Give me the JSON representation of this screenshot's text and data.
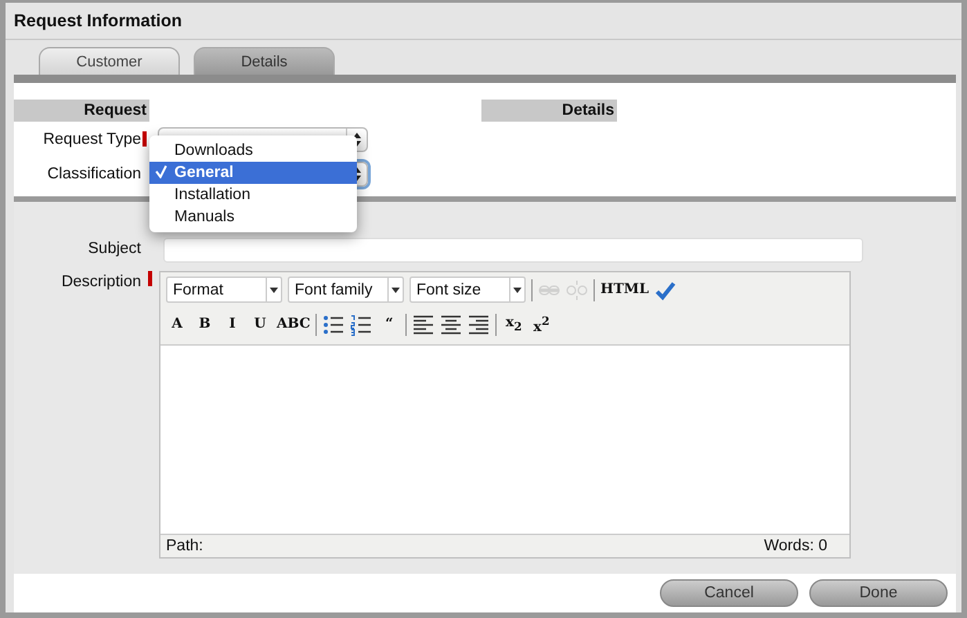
{
  "window": {
    "title": "Request Information"
  },
  "tabs": [
    {
      "label": "Customer",
      "selected": false
    },
    {
      "label": "Details",
      "selected": true
    }
  ],
  "headers": [
    "Request",
    "Details"
  ],
  "fields": [
    {
      "label": "Request Type",
      "required": true,
      "focused": false
    },
    {
      "label": "Classification",
      "required": false,
      "focused": true
    }
  ],
  "dropdown": {
    "options": [
      {
        "label": "Downloads",
        "selected": false
      },
      {
        "label": "General",
        "selected": true
      },
      {
        "label": "Installation",
        "selected": false
      },
      {
        "label": "Manuals",
        "selected": false
      }
    ]
  },
  "subject": {
    "label": "Subject"
  },
  "description": {
    "label": "Description",
    "required": true
  },
  "toolbar": [
    [
      {
        "kind": "select",
        "label": "Format"
      },
      {
        "kind": "select",
        "label": "Font family"
      },
      {
        "kind": "select",
        "label": "Font size"
      },
      {
        "kind": "sep"
      },
      {
        "kind": "icon",
        "disabled": true
      },
      {
        "kind": "icon",
        "disabled": true
      },
      {
        "kind": "sep"
      },
      {
        "kind": "text",
        "label": "HTML"
      },
      {
        "kind": "icon",
        "disabled": false
      }
    ],
    [
      {
        "kind": "text",
        "label": "A"
      },
      {
        "kind": "text",
        "label": "B"
      },
      {
        "kind": "text",
        "label": "I"
      },
      {
        "kind": "text",
        "label": "U"
      },
      {
        "kind": "text",
        "label": "ABC"
      },
      {
        "kind": "sep"
      },
      {
        "kind": "icon",
        "disabled": false
      },
      {
        "kind": "icon",
        "disabled": false
      },
      {
        "kind": "text",
        "label": "“"
      },
      {
        "kind": "sep"
      },
      {
        "kind": "icon",
        "disabled": false
      },
      {
        "kind": "icon",
        "disabled": false
      },
      {
        "kind": "icon",
        "disabled": false
      },
      {
        "kind": "sep"
      },
      {
        "kind": "text",
        "label": "x$_{2}$"
      },
      {
        "kind": "text",
        "label": "x$^{2}$"
      }
    ]
  ],
  "status": {
    "path": "Path:",
    "words": "Words: 0"
  },
  "buttons": [
    "Cancel",
    "Done"
  ]
}
